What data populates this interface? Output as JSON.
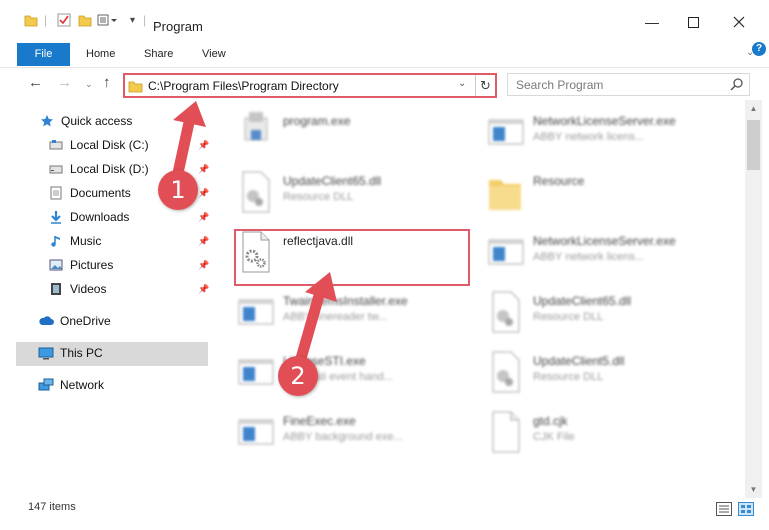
{
  "window": {
    "title": "Program"
  },
  "ribbon": {
    "tabs": [
      {
        "label": "File"
      },
      {
        "label": "Home"
      },
      {
        "label": "Share"
      },
      {
        "label": "View"
      }
    ]
  },
  "address": {
    "path": "C:\\Program Files\\Program Directory"
  },
  "search": {
    "placeholder": "Search Program"
  },
  "sidebar": {
    "items": [
      {
        "label": "Quick access",
        "icon": "star-icon"
      },
      {
        "label": "Local Disk (C:)",
        "icon": "drive-icon"
      },
      {
        "label": "Local Disk (D:)",
        "icon": "drive-icon"
      },
      {
        "label": "Documents",
        "icon": "documents-icon"
      },
      {
        "label": "Downloads",
        "icon": "download-icon"
      },
      {
        "label": "Music",
        "icon": "music-icon"
      },
      {
        "label": "Pictures",
        "icon": "pictures-icon"
      },
      {
        "label": "Videos",
        "icon": "videos-icon"
      },
      {
        "label": "OneDrive",
        "icon": "cloud-icon"
      },
      {
        "label": "This PC",
        "icon": "computer-icon"
      },
      {
        "label": "Network",
        "icon": "network-icon"
      }
    ]
  },
  "files": [
    {
      "name": "program.exe",
      "desc": "",
      "icon": "installer-icon"
    },
    {
      "name": "NetworkLicenseServer.exe",
      "desc": "ABBY network licens...",
      "icon": "exe-window-icon"
    },
    {
      "name": "UpdateClient65.dll",
      "desc": "Resource DLL",
      "icon": "dll-icon"
    },
    {
      "name": "Resource",
      "desc": "",
      "icon": "folder-icon"
    },
    {
      "name": "reflectjava.dll",
      "desc": "",
      "icon": "dll-gear-icon"
    },
    {
      "name": "NetworkLicenseServer.exe",
      "desc": "ABBY network licens...",
      "icon": "exe-window-icon"
    },
    {
      "name": "TwainItemsInstaller.exe",
      "desc": "ABBY finereader tw...",
      "icon": "exe-window-icon"
    },
    {
      "name": "UpdateClient65.dll",
      "desc": "Resource DLL",
      "icon": "dll-icon"
    },
    {
      "name": "LicenseSTI.exe",
      "desc": "ABBY sti event hand...",
      "icon": "exe-window-icon"
    },
    {
      "name": "UpdateClient5.dll",
      "desc": "Resource DLL",
      "icon": "dll-icon"
    },
    {
      "name": "FineExec.exe",
      "desc": "ABBY background exe...",
      "icon": "exe-window-icon"
    },
    {
      "name": "gtd.cjk",
      "desc": "CJK File",
      "icon": "file-icon"
    }
  ],
  "annotations": {
    "step1": "1",
    "step2": "2"
  },
  "status": {
    "items": "147 items"
  },
  "colors": {
    "accent": "#1979ca",
    "highlight": "#e05b66",
    "badge": "#e14e55"
  }
}
